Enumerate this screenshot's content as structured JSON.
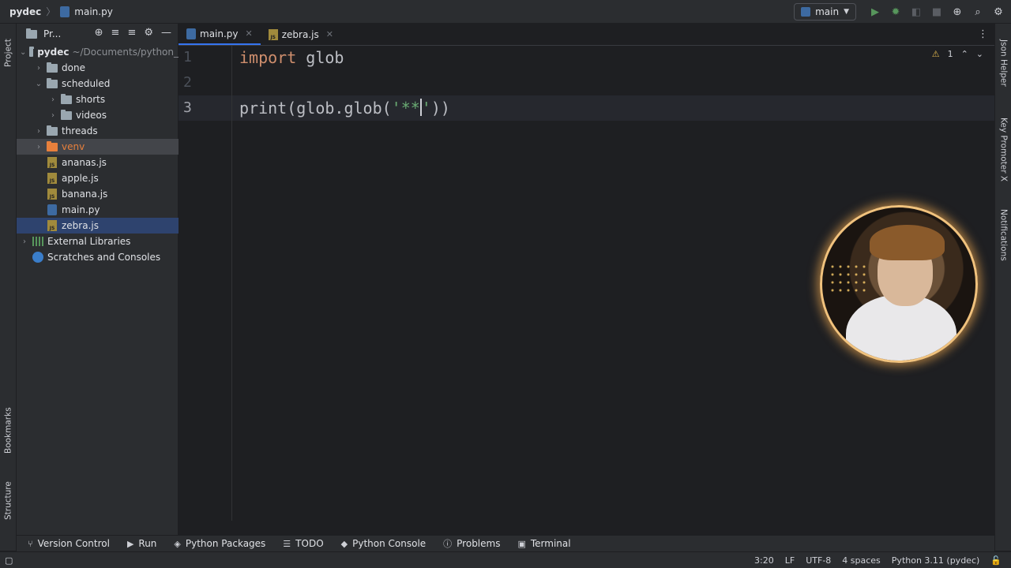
{
  "titlebar": {
    "project": "pydec",
    "file": "main.py",
    "branch": "main"
  },
  "project_panel": {
    "title": "Pr...",
    "tree": [
      {
        "label": "pydec",
        "path": "~/Documents/python_",
        "type": "root"
      },
      {
        "label": "done",
        "type": "folder"
      },
      {
        "label": "scheduled",
        "type": "folder"
      },
      {
        "label": "shorts",
        "type": "folder"
      },
      {
        "label": "videos",
        "type": "folder"
      },
      {
        "label": "threads",
        "type": "folder"
      },
      {
        "label": "venv",
        "type": "folder-excluded"
      },
      {
        "label": "ananas.js",
        "type": "js"
      },
      {
        "label": "apple.js",
        "type": "js"
      },
      {
        "label": "banana.js",
        "type": "js"
      },
      {
        "label": "main.py",
        "type": "py"
      },
      {
        "label": "zebra.js",
        "type": "js"
      },
      {
        "label": "External Libraries",
        "type": "lib"
      },
      {
        "label": "Scratches and Consoles",
        "type": "scratch"
      }
    ]
  },
  "tabs": [
    {
      "label": "main.py",
      "active": true
    },
    {
      "label": "zebra.js",
      "active": false
    }
  ],
  "editor": {
    "line_numbers": [
      "1",
      "2",
      "3"
    ],
    "line1": {
      "kw": "import",
      "rest": " glob"
    },
    "line3": {
      "fn": "print",
      "p1": "(glob.glob(",
      "str": "'**",
      "str_end": "'",
      "p2": "))"
    },
    "warnings": "1"
  },
  "side_labels": {
    "project": "Project",
    "bookmarks": "Bookmarks",
    "structure": "Structure",
    "json_helper": "Json Helper",
    "key_promoter": "Key Promoter X",
    "notifications": "Notifications"
  },
  "bottom_tools": [
    "Version Control",
    "Run",
    "Python Packages",
    "TODO",
    "Python Console",
    "Problems",
    "Terminal"
  ],
  "statusbar": {
    "position": "3:20",
    "line_sep": "LF",
    "encoding": "UTF-8",
    "indent": "4 spaces",
    "interpreter": "Python 3.11 (pydec)"
  },
  "colors": {
    "accent": "#3574f0",
    "keyword": "#cf8e6d",
    "string": "#6aab73"
  }
}
